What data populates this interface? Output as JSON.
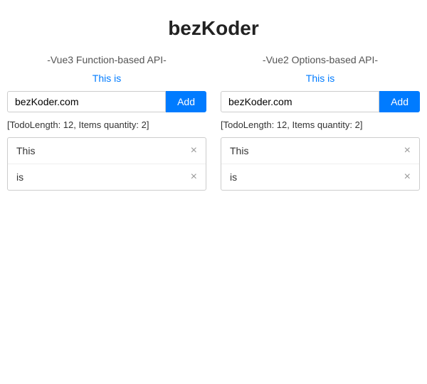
{
  "title": "bezKoder",
  "columns": [
    {
      "id": "vue3-column",
      "title": "-Vue3 Function-based API-",
      "this_is_label": "This is",
      "input_value": "bezKoder.com",
      "input_placeholder": "bezKoder.com",
      "add_button_label": "Add",
      "todo_info": "[TodoLength: 12, Items quantity: 2]",
      "items": [
        {
          "text": "This"
        },
        {
          "text": "is"
        }
      ]
    },
    {
      "id": "vue2-column",
      "title": "-Vue2 Options-based API-",
      "this_is_label": "This is",
      "input_value": "bezKoder.com",
      "input_placeholder": "bezKoder.com",
      "add_button_label": "Add",
      "todo_info": "[TodoLength: 12, Items quantity: 2]",
      "items": [
        {
          "text": "This"
        },
        {
          "text": "is"
        }
      ]
    }
  ]
}
